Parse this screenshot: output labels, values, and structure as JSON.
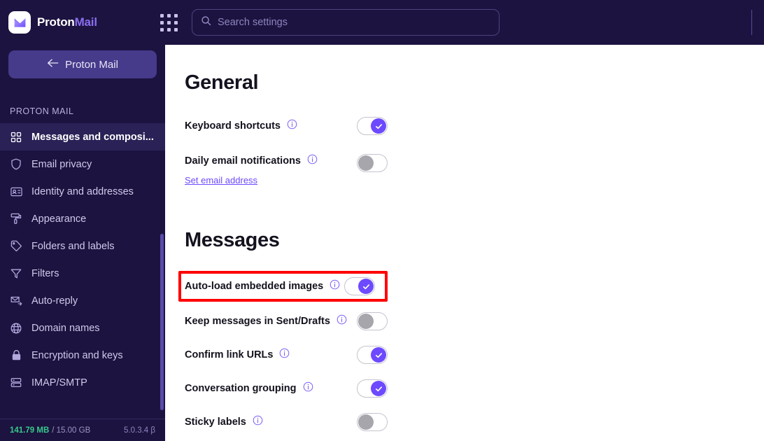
{
  "app": {
    "brand_first": "Proton",
    "brand_second": "Mail",
    "logo_icon": "proton-mail-envelope-icon",
    "apps_icon": "apps-grid-icon"
  },
  "search": {
    "placeholder": "Search settings",
    "value": "",
    "icon": "search-icon"
  },
  "sidebar": {
    "back_button": "Proton Mail",
    "back_icon": "arrow-left-icon",
    "heading": "PROTON MAIL",
    "items": [
      {
        "label": "Messages and composi...",
        "icon": "squares-grid-icon",
        "active": true
      },
      {
        "label": "Email privacy",
        "icon": "shield-icon",
        "active": false
      },
      {
        "label": "Identity and addresses",
        "icon": "id-card-icon",
        "active": false
      },
      {
        "label": "Appearance",
        "icon": "paint-roller-icon",
        "active": false
      },
      {
        "label": "Folders and labels",
        "icon": "tags-icon",
        "active": false
      },
      {
        "label": "Filters",
        "icon": "funnel-icon",
        "active": false
      },
      {
        "label": "Auto-reply",
        "icon": "envelope-arrow-icon",
        "active": false
      },
      {
        "label": "Domain names",
        "icon": "globe-icon",
        "active": false
      },
      {
        "label": "Encryption and keys",
        "icon": "lock-icon",
        "active": false
      },
      {
        "label": "IMAP/SMTP",
        "icon": "server-icon",
        "active": false
      }
    ],
    "footer": {
      "storage_used": "141.79 MB",
      "storage_total": "/ 15.00 GB",
      "version": "5.0.3.4 β"
    }
  },
  "main": {
    "sections": [
      {
        "title": "General",
        "rows": [
          {
            "label": "Keyboard shortcuts",
            "info_icon": "info-icon",
            "toggle": "on",
            "sub_link": null
          },
          {
            "label": "Daily email notifications",
            "info_icon": "info-icon",
            "toggle": "off",
            "sub_link": "Set email address"
          }
        ]
      },
      {
        "title": "Messages",
        "rows": [
          {
            "label": "Auto-load embedded images",
            "info_icon": "info-icon",
            "toggle": "on",
            "sub_link": null,
            "highlighted": true
          },
          {
            "label": "Keep messages in Sent/Drafts",
            "info_icon": "info-icon",
            "toggle": "off",
            "sub_link": null
          },
          {
            "label": "Confirm link URLs",
            "info_icon": "info-icon",
            "toggle": "on",
            "sub_link": null
          },
          {
            "label": "Conversation grouping",
            "info_icon": "info-icon",
            "toggle": "on",
            "sub_link": null
          },
          {
            "label": "Sticky labels",
            "info_icon": "info-icon",
            "toggle": "off",
            "sub_link": null
          }
        ]
      }
    ]
  },
  "colors": {
    "accent": "#6d4aff",
    "background_dark": "#1c1340",
    "sidebar_active": "#2a2256",
    "highlight": "#ff0000",
    "storage_ok": "#37c98a"
  }
}
